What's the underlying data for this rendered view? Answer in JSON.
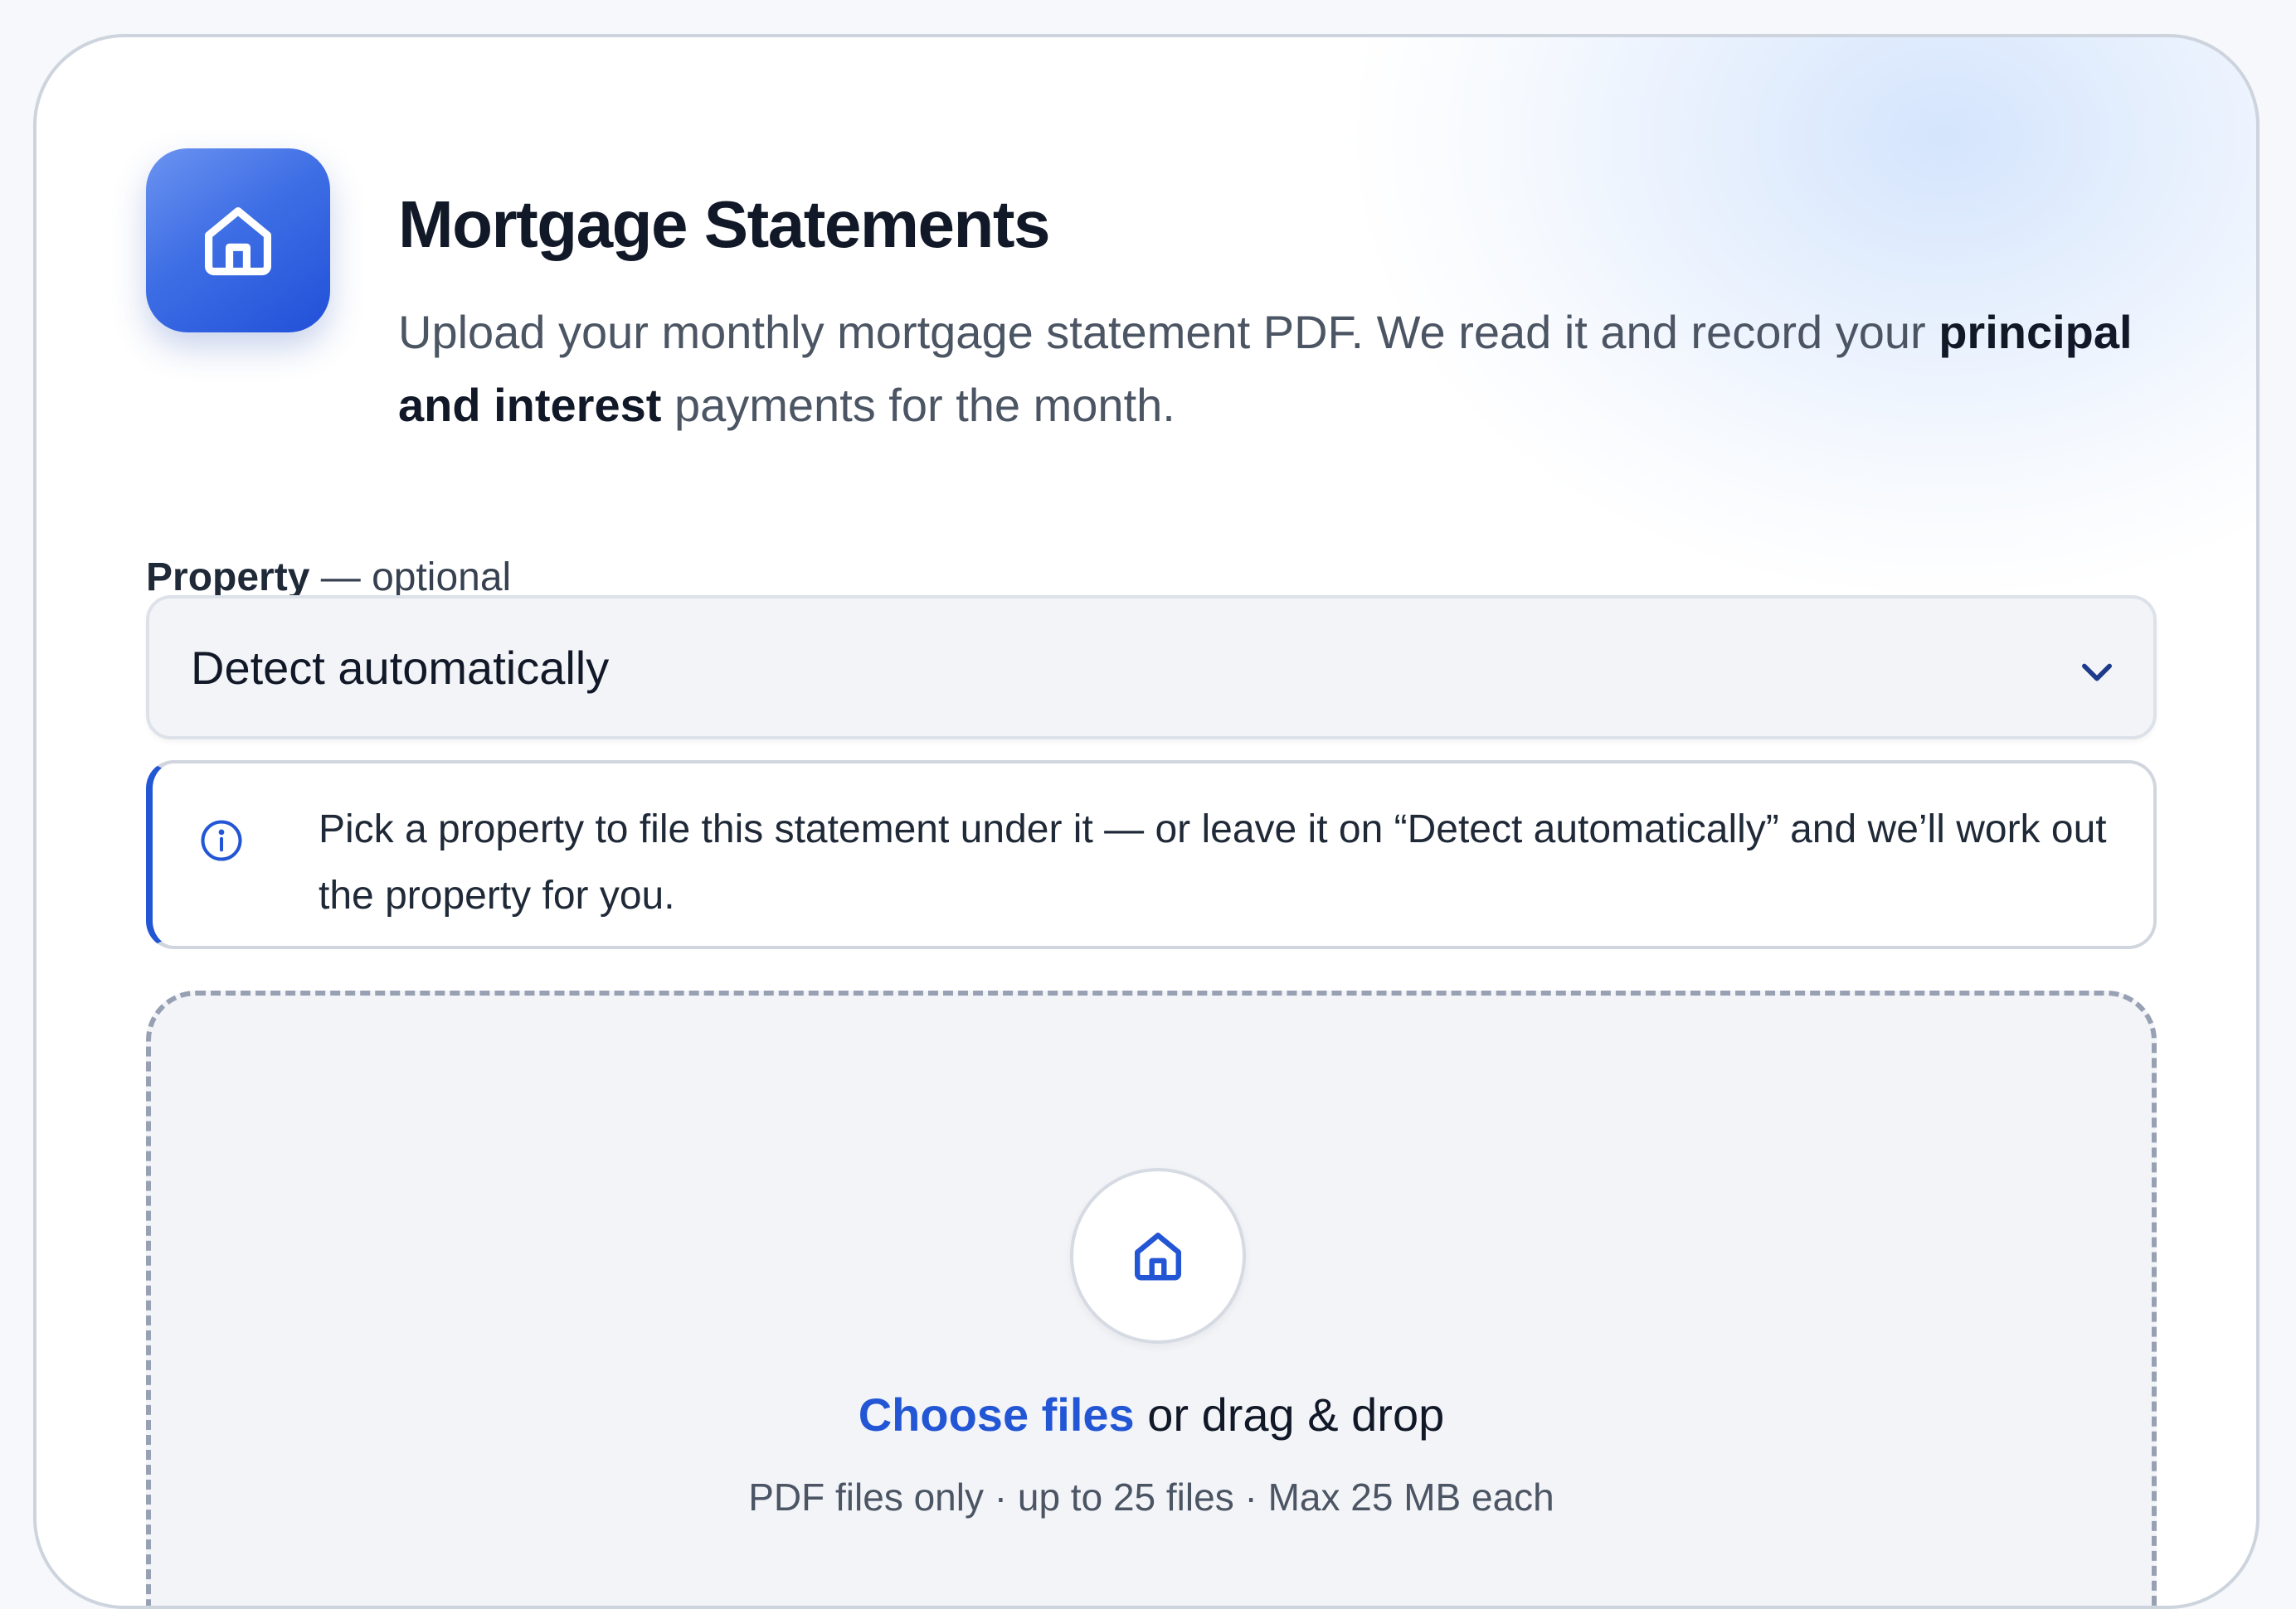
{
  "header": {
    "title": "Mortgage Statements",
    "description_before": "Upload your monthly mortgage statement PDF. We read it and record your ",
    "description_bold": "principal and interest",
    "description_after": " payments for the month.",
    "icon": "home-icon"
  },
  "property": {
    "label": "Property",
    "label_suffix": " — optional",
    "selected": "Detect automatically",
    "info_text": "Pick a property to file this statement under it — or leave it on “Detect automatically” and we’ll work out the property for you."
  },
  "dropzone": {
    "icon": "home-icon",
    "choose_label": "Choose files",
    "drag_label": " or drag & drop",
    "hint": "PDF files only · up to 25 files · Max 25 MB each"
  },
  "colors": {
    "accent": "#2356d4",
    "icon_gradient_start": "#6b93f0",
    "icon_gradient_end": "#2150d8"
  }
}
